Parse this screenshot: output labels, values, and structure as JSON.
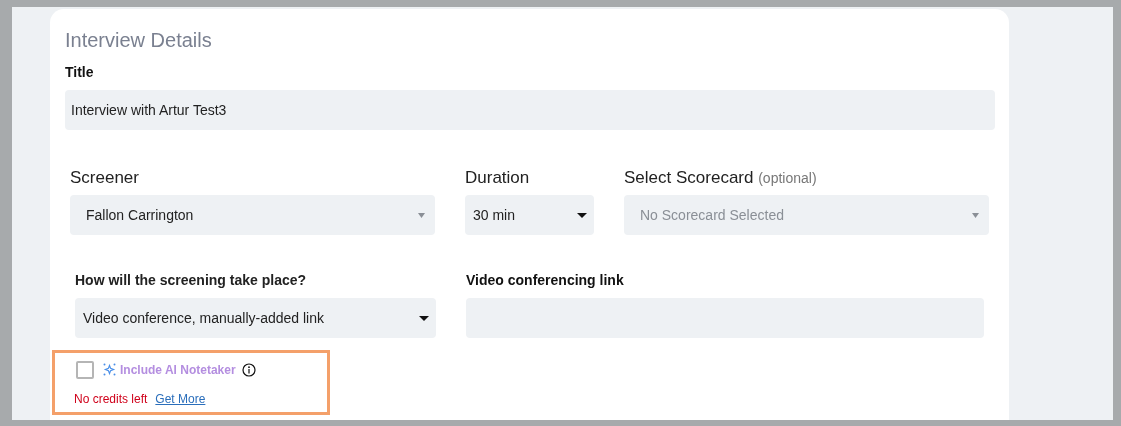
{
  "section": {
    "title": "Interview Details"
  },
  "title_field": {
    "label": "Title",
    "value": "Interview with Artur Test3"
  },
  "selects": [
    {
      "label": "Screener",
      "value": "Fallon Carrington",
      "kind": "styled"
    },
    {
      "label": "Duration",
      "value": "30 min",
      "kind": "native"
    },
    {
      "label": "Select Scorecard",
      "hint": "(optional)",
      "placeholder": "No Scorecard Selected",
      "kind": "styled"
    }
  ],
  "location": {
    "label": "How will the screening take place?",
    "value": "Video conference, manually-added link",
    "kind": "native"
  },
  "link_field": {
    "label": "Video conferencing link"
  },
  "notetaker": {
    "checked": false,
    "highlighted": true,
    "label": "Include AI Notetaker",
    "credits_message": "No credits left",
    "link": "Get More"
  }
}
